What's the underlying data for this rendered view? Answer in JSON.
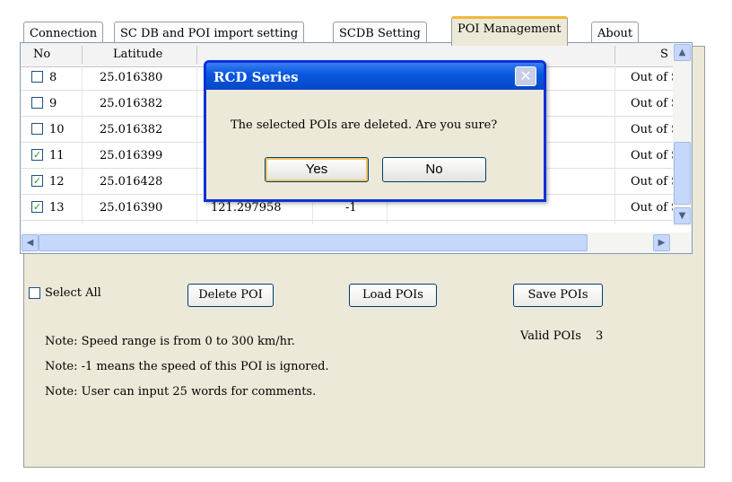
{
  "tabs": [
    {
      "label": "Connection"
    },
    {
      "label": "SC DB and POI import setting"
    },
    {
      "label": "SCDB  Setting"
    },
    {
      "label": "POI Management"
    },
    {
      "label": "About"
    }
  ],
  "grid": {
    "columns": {
      "no": "No",
      "latitude": "Latitude",
      "s_partial": "S"
    },
    "rows": [
      {
        "no": "8",
        "checked": false,
        "latitude": "25.016380",
        "longitude": "",
        "speed": "",
        "comment": "Out of S"
      },
      {
        "no": "9",
        "checked": false,
        "latitude": "25.016382",
        "longitude": "",
        "speed": "",
        "comment": "Out of S"
      },
      {
        "no": "10",
        "checked": false,
        "latitude": "25.016382",
        "longitude": "",
        "speed": "",
        "comment": "Out of S"
      },
      {
        "no": "11",
        "checked": true,
        "latitude": "25.016399",
        "longitude": "",
        "speed": "",
        "comment": "Out of S"
      },
      {
        "no": "12",
        "checked": true,
        "latitude": "25.016428",
        "longitude": "",
        "speed": "",
        "comment": "Out of S"
      },
      {
        "no": "13",
        "checked": true,
        "latitude": "25.016390",
        "longitude": "121.297958",
        "speed": "-1",
        "comment": "Out of S"
      }
    ]
  },
  "controls": {
    "select_all_label": "Select All",
    "delete_button": "Delete POI",
    "load_button": "Load POIs",
    "save_button": "Save POIs",
    "valid_pois_label": "Valid POIs",
    "valid_pois_count": "3"
  },
  "notes": [
    "Note: Speed range is from 0 to 300 km/hr.",
    "Note: -1 means the speed of this POI is ignored.",
    "Note:  User can input 25 words for comments."
  ],
  "dialog": {
    "title": "RCD Series",
    "message": "The selected POIs  are deleted. Are you sure?",
    "yes_label": "Yes",
    "no_label": "No",
    "close_glyph": "✕"
  },
  "colors": {
    "dialog_title_blue": "#0a5ae0",
    "panel_bg": "#ece9d8",
    "active_tab_accent": "#f0b838",
    "check_green": "#21a121"
  }
}
